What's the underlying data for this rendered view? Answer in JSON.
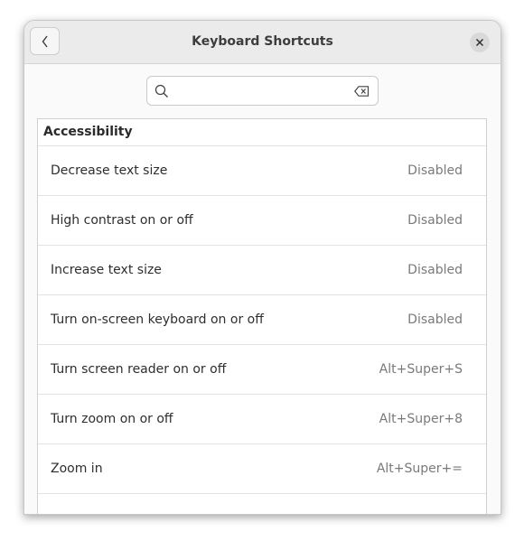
{
  "window": {
    "title": "Keyboard Shortcuts"
  },
  "icons": {
    "back": "chevron-left-icon",
    "close": "close-icon",
    "search": "search-icon",
    "clear": "backspace-clear-icon"
  },
  "search": {
    "value": "",
    "placeholder": ""
  },
  "section": {
    "title": "Accessibility"
  },
  "shortcuts": [
    {
      "label": "Decrease text size",
      "accel": "Disabled"
    },
    {
      "label": "High contrast on or off",
      "accel": "Disabled"
    },
    {
      "label": "Increase text size",
      "accel": "Disabled"
    },
    {
      "label": "Turn on-screen keyboard on or off",
      "accel": "Disabled"
    },
    {
      "label": "Turn screen reader on or off",
      "accel": "Alt+Super+S"
    },
    {
      "label": "Turn zoom on or off",
      "accel": "Alt+Super+8"
    },
    {
      "label": "Zoom in",
      "accel": "Alt+Super+="
    }
  ],
  "colors": {
    "headerbar": "#ebebeb",
    "background": "#fafafa",
    "accel_text": "#7a7a7a"
  }
}
